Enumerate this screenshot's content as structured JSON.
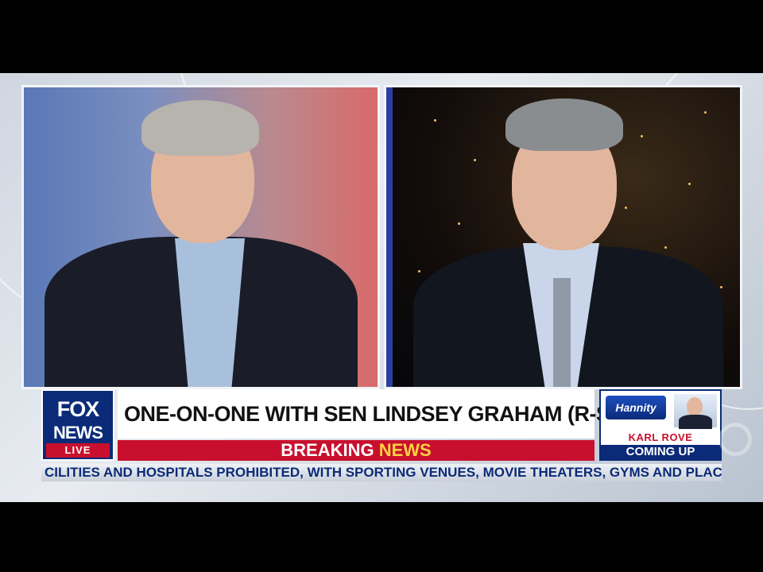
{
  "lower_third": {
    "headline": "ONE-ON-ONE WITH SEN LINDSEY GRAHAM (R-SC)",
    "breaking_word1": "BREAKING",
    "breaking_word2": "NEWS",
    "ticker": "CILITIES AND HOSPITALS PROHIBITED, WITH SPORTING VENUES, MOVIE THEATERS, GYMS AND PLACES OF V"
  },
  "logo": {
    "line1": "FOX",
    "line2": "NEWS",
    "badge": "LIVE"
  },
  "promo": {
    "show_name": "Hannity",
    "guest_name": "KARL ROVE",
    "status": "COMING UP"
  },
  "colors": {
    "network_blue": "#0b2a78",
    "breaking_red": "#c8102e",
    "breaking_yellow": "#ffd23f"
  }
}
